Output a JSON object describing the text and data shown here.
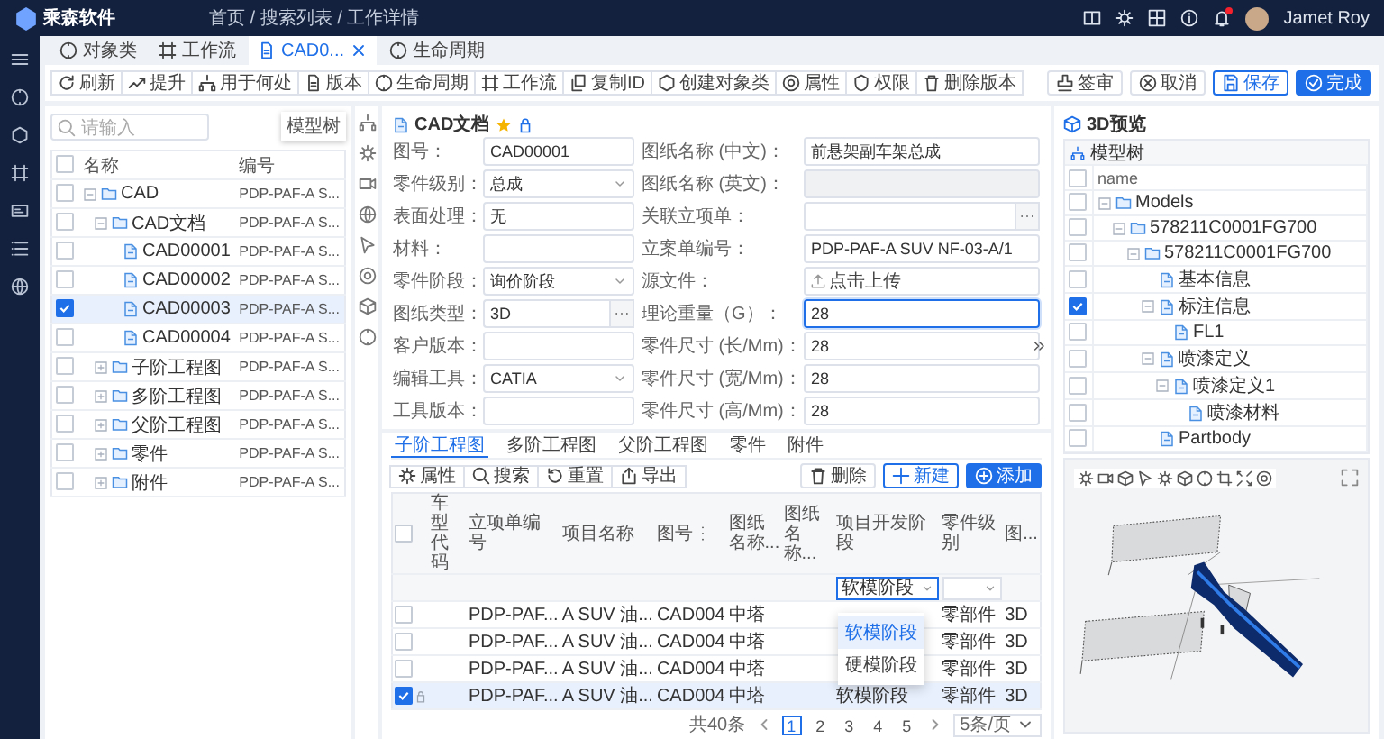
{
  "header": {
    "logo": "乘森软件",
    "breadcrumb": "首页 / 搜索列表 / 工作详情",
    "user": "Jamet Roy",
    "has_notification": true
  },
  "page_tabs": [
    {
      "label": "对象类",
      "selected": false,
      "closable": false
    },
    {
      "label": "工作流",
      "selected": false,
      "closable": false
    },
    {
      "label": "CAD0...",
      "selected": true,
      "closable": true
    },
    {
      "label": "生命周期",
      "selected": false,
      "closable": false
    }
  ],
  "toolbar": [
    "刷新",
    "提升",
    "用于何处",
    "版本",
    "生命周期",
    "工作流",
    "复制ID",
    "创建对象类",
    "属性",
    "权限",
    "删除版本"
  ],
  "actions": [
    {
      "label": "签审",
      "kind": "default"
    },
    {
      "label": "取消",
      "kind": "default"
    },
    {
      "label": "保存",
      "kind": "outline"
    },
    {
      "label": "完成",
      "kind": "primary"
    }
  ],
  "object_tree": {
    "search_placeholder": "请输入",
    "tooltip": "模型树",
    "all_checked": false,
    "columns": [
      "名称",
      "编号"
    ],
    "rows": [
      {
        "name": "CAD",
        "code": "PDP-PAF-A S...",
        "checked": false,
        "kind": "folder",
        "expanded": true,
        "children": [
          {
            "name": "CAD文档",
            "code": "PDP-PAF-A S...",
            "checked": false,
            "kind": "folder",
            "expanded": true,
            "children": [
              {
                "name": "CAD00001",
                "code": "PDP-PAF-A S...",
                "checked": false,
                "kind": "file"
              },
              {
                "name": "CAD00002",
                "code": "PDP-PAF-A S...",
                "checked": false,
                "kind": "file"
              },
              {
                "name": "CAD00003",
                "code": "PDP-PAF-A S...",
                "checked": true,
                "kind": "file"
              },
              {
                "name": "CAD00004",
                "code": "PDP-PAF-A S...",
                "checked": false,
                "kind": "file"
              }
            ]
          },
          {
            "name": "子阶工程图",
            "code": "PDP-PAF-A S...",
            "checked": false,
            "kind": "folder",
            "expanded": false
          },
          {
            "name": "多阶工程图",
            "code": "PDP-PAF-A S...",
            "checked": false,
            "kind": "folder",
            "expanded": false
          },
          {
            "name": "父阶工程图",
            "code": "PDP-PAF-A S...",
            "checked": false,
            "kind": "folder",
            "expanded": false
          },
          {
            "name": "零件",
            "code": "PDP-PAF-A S...",
            "checked": false,
            "kind": "folder",
            "expanded": false
          },
          {
            "name": "附件",
            "code": "PDP-PAF-A S...",
            "checked": false,
            "kind": "folder",
            "expanded": false
          }
        ]
      }
    ]
  },
  "document": {
    "title": "CAD文档",
    "favorite": true,
    "fields": [
      {
        "label": "图号：",
        "kind": "text",
        "value": "CAD00001",
        "focused": false
      },
      {
        "label": "图纸名称 (中文)：",
        "kind": "text",
        "value": "前悬架副车架总成",
        "focused": false
      },
      {
        "label": "零件级别：",
        "kind": "select",
        "value": "总成",
        "focused": false
      },
      {
        "label": "图纸名称 (英文)：",
        "kind": "disabled",
        "focused": false
      },
      {
        "label": "表面处理：",
        "kind": "text",
        "value": "无",
        "focused": false
      },
      {
        "label": "关联立项单：",
        "kind": "lookup",
        "focused": false
      },
      {
        "label": "材料：",
        "kind": "text",
        "focused": false
      },
      {
        "label": "立案单编号：",
        "kind": "text",
        "value": "PDP-PAF-A SUV NF-03-A/1",
        "focused": false
      },
      {
        "label": "零件阶段：",
        "kind": "select",
        "value": "询价阶段",
        "focused": false
      },
      {
        "label": "源文件：",
        "kind": "upload",
        "value": "点击上传",
        "focused": false
      },
      {
        "label": "图纸类型：",
        "kind": "lookup",
        "value": "3D",
        "focused": false
      },
      {
        "label": "理论重量（G）：",
        "kind": "text",
        "value": "28",
        "focused": true
      },
      {
        "label": "客户版本：",
        "kind": "text",
        "focused": false
      },
      {
        "label": "零件尺寸 (长/Mm)：",
        "kind": "text",
        "value": "28",
        "focused": false
      },
      {
        "label": "编辑工具：",
        "kind": "select",
        "value": "CATIA",
        "focused": false
      },
      {
        "label": "零件尺寸 (宽/Mm)：",
        "kind": "text",
        "value": "28",
        "focused": false
      },
      {
        "label": "工具版本：",
        "kind": "text",
        "focused": false
      },
      {
        "label": "零件尺寸 (高/Mm)：",
        "kind": "text",
        "value": "28",
        "focused": false
      }
    ]
  },
  "related": {
    "tabs": [
      {
        "label": "子阶工程图",
        "selected": true
      },
      {
        "label": "多阶工程图",
        "selected": false
      },
      {
        "label": "父阶工程图",
        "selected": false
      },
      {
        "label": "零件",
        "selected": false
      },
      {
        "label": "附件",
        "selected": false
      }
    ],
    "tools": [
      "属性",
      "搜索",
      "重置",
      "导出"
    ],
    "actions": [
      {
        "label": "删除",
        "kind": "default"
      },
      {
        "label": "新建",
        "kind": "outline"
      },
      {
        "label": "添加",
        "kind": "primary"
      }
    ],
    "all_checked": false,
    "columns": [
      {
        "label": "车型代码",
        "sortable": false
      },
      {
        "label": "立项单编号",
        "sortable": false
      },
      {
        "label": "项目名称",
        "sortable": false
      },
      {
        "label": "图号",
        "sortable": true
      },
      {
        "label": "图纸名称...",
        "sortable": false
      },
      {
        "label": "图纸名称...",
        "sortable": false
      },
      {
        "label": "项目开发阶段",
        "sortable": false
      },
      {
        "label": "零件级别",
        "sortable": false
      },
      {
        "label": "图...",
        "sortable": false
      }
    ],
    "filters": [
      {
        "kind": "none"
      },
      {
        "kind": "none"
      },
      {
        "kind": "none"
      },
      {
        "kind": "none"
      },
      {
        "kind": "none"
      },
      {
        "kind": "none"
      },
      {
        "kind": "select",
        "value": "软模阶段",
        "open": true,
        "options": [
          {
            "label": "软模阶段",
            "selected": true
          },
          {
            "label": "硬模阶段",
            "selected": false
          }
        ]
      },
      {
        "kind": "select",
        "open": false
      },
      {
        "kind": "none"
      }
    ],
    "rows": [
      {
        "checked": false,
        "locked": false,
        "cells": [
          {
            "kind": "empty"
          },
          {
            "kind": "text",
            "text": "PDP-PAF..."
          },
          {
            "kind": "text",
            "text": "A SUV 油..."
          },
          {
            "kind": "text",
            "text": "CAD004"
          },
          {
            "kind": "text",
            "text": "中塔"
          },
          {
            "kind": "empty"
          },
          {
            "kind": "empty"
          },
          {
            "kind": "text",
            "text": "零部件"
          },
          {
            "kind": "text",
            "text": "3D"
          }
        ]
      },
      {
        "checked": false,
        "locked": false,
        "cells": [
          {
            "kind": "empty"
          },
          {
            "kind": "text",
            "text": "PDP-PAF..."
          },
          {
            "kind": "text",
            "text": "A SUV 油..."
          },
          {
            "kind": "text",
            "text": "CAD004"
          },
          {
            "kind": "text",
            "text": "中塔"
          },
          {
            "kind": "empty"
          },
          {
            "kind": "empty"
          },
          {
            "kind": "text",
            "text": "零部件"
          },
          {
            "kind": "text",
            "text": "3D"
          }
        ]
      },
      {
        "checked": false,
        "locked": false,
        "cells": [
          {
            "kind": "empty"
          },
          {
            "kind": "text",
            "text": "PDP-PAF..."
          },
          {
            "kind": "text",
            "text": "A SUV 油..."
          },
          {
            "kind": "text",
            "text": "CAD004"
          },
          {
            "kind": "text",
            "text": "中塔"
          },
          {
            "kind": "empty"
          },
          {
            "kind": "empty"
          },
          {
            "kind": "text",
            "text": "零部件"
          },
          {
            "kind": "text",
            "text": "3D"
          }
        ]
      },
      {
        "checked": true,
        "locked": true,
        "cells": [
          {
            "kind": "empty"
          },
          {
            "kind": "text",
            "text": "PDP-PAF..."
          },
          {
            "kind": "text",
            "text": "A SUV 油..."
          },
          {
            "kind": "text",
            "text": "CAD004"
          },
          {
            "kind": "text",
            "text": "中塔"
          },
          {
            "kind": "empty"
          },
          {
            "kind": "text",
            "text": "软模阶段"
          },
          {
            "kind": "text",
            "text": "零部件"
          },
          {
            "kind": "text",
            "text": "3D"
          }
        ]
      }
    ],
    "pagination": {
      "total": "共40条",
      "pages": [
        {
          "label": "1",
          "selected": true
        },
        {
          "label": "2",
          "selected": false
        },
        {
          "label": "3",
          "selected": false
        },
        {
          "label": "4",
          "selected": false
        },
        {
          "label": "5",
          "selected": false
        }
      ],
      "page_size": "5条/页"
    }
  },
  "preview": {
    "title": "3D预览",
    "tree_title": "模型树",
    "column": "name",
    "all_checked": false,
    "rows": [
      {
        "name": "Models",
        "checked": false,
        "kind": "folder",
        "expanded": true,
        "children": [
          {
            "name": "578211C0001FG700",
            "checked": false,
            "kind": "folder",
            "expanded": true,
            "children": [
              {
                "name": "578211C0001FG700",
                "checked": false,
                "kind": "folder",
                "expanded": true,
                "children": [
                  {
                    "name": "基本信息",
                    "checked": false,
                    "kind": "file"
                  },
                  {
                    "name": "标注信息",
                    "checked": true,
                    "kind": "file",
                    "expanded": true,
                    "children": [
                      {
                        "name": "FL1",
                        "checked": false,
                        "kind": "file"
                      }
                    ]
                  },
                  {
                    "name": "喷漆定义",
                    "checked": false,
                    "kind": "file",
                    "expanded": true,
                    "children": [
                      {
                        "name": "喷漆定义1",
                        "checked": false,
                        "kind": "file",
                        "expanded": true,
                        "children": [
                          {
                            "name": "喷漆材料",
                            "checked": false,
                            "kind": "file"
                          }
                        ]
                      }
                    ]
                  },
                  {
                    "name": "Partbody",
                    "checked": false,
                    "kind": "file"
                  }
                ]
              }
            ]
          }
        ]
      }
    ]
  }
}
